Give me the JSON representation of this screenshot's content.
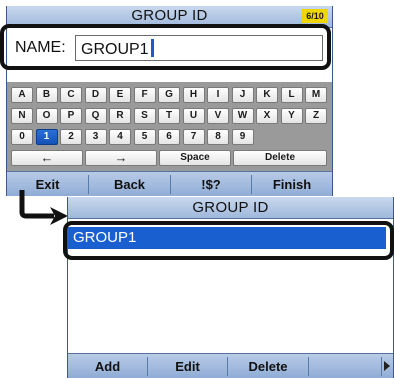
{
  "top_screen": {
    "title": "GROUP ID",
    "page_indicator": "6/10",
    "name_label": "NAME:",
    "name_value": "GROUP1",
    "keyboard": {
      "row1": [
        "A",
        "B",
        "C",
        "D",
        "E",
        "F",
        "G",
        "H",
        "I",
        "J",
        "K",
        "L",
        "M"
      ],
      "row2": [
        "N",
        "O",
        "P",
        "Q",
        "R",
        "S",
        "T",
        "U",
        "V",
        "W",
        "X",
        "Y",
        "Z"
      ],
      "row3": [
        "0",
        "1",
        "2",
        "3",
        "4",
        "5",
        "6",
        "7",
        "8",
        "9"
      ],
      "selected_key": "1",
      "row4": {
        "left_arrow": "←",
        "right_arrow": "→",
        "space": "Space",
        "delete": "Delete"
      }
    },
    "softkeys": [
      "Exit",
      "Back",
      "!$?",
      "Finish"
    ]
  },
  "bottom_screen": {
    "title": "GROUP ID",
    "list_items": [
      "GROUP1"
    ],
    "softkeys": [
      "Add",
      "Edit",
      "Delete"
    ]
  },
  "colors": {
    "selection_blue": "#1a5fcf",
    "title_bar": "#b6cae6",
    "page_indicator": "#f0d600",
    "highlight_frame": "#111111"
  }
}
